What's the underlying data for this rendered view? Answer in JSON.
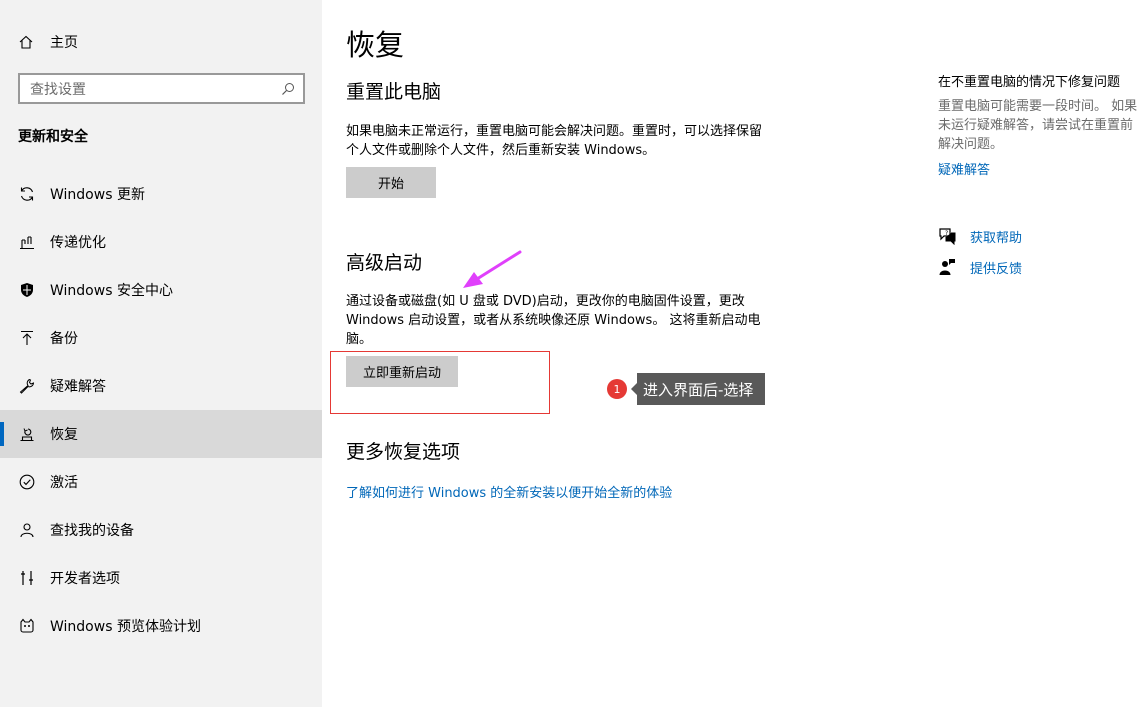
{
  "sidebar": {
    "home_label": "主页",
    "search_placeholder": "查找设置",
    "section_title": "更新和安全",
    "items": [
      {
        "label": "Windows 更新",
        "icon": "refresh-icon"
      },
      {
        "label": "传递优化",
        "icon": "delivery-optimization-icon"
      },
      {
        "label": "Windows 安全中心",
        "icon": "shield-icon"
      },
      {
        "label": "备份",
        "icon": "backup-arrow-icon"
      },
      {
        "label": "疑难解答",
        "icon": "wrench-icon"
      },
      {
        "label": "恢复",
        "icon": "recovery-icon",
        "active": true
      },
      {
        "label": "激活",
        "icon": "check-circle-icon"
      },
      {
        "label": "查找我的设备",
        "icon": "find-device-icon"
      },
      {
        "label": "开发者选项",
        "icon": "developer-icon"
      },
      {
        "label": "Windows 预览体验计划",
        "icon": "insider-icon"
      }
    ]
  },
  "main": {
    "title": "恢复",
    "reset": {
      "heading": "重置此电脑",
      "line1": "如果电脑未正常运行，重置电脑可能会解决问题。重置时，可以选择保留",
      "line2": "个人文件或删除个人文件，然后重新安装 Windows。",
      "button": "开始"
    },
    "advanced": {
      "heading": "高级启动",
      "line1": "通过设备或磁盘(如 U 盘或 DVD)启动，更改你的电脑固件设置，更改",
      "line2": "Windows 启动设置，或者从系统映像还原 Windows。 这将重新启动电",
      "line3": "脑。",
      "button": "立即重新启动"
    },
    "more": {
      "heading": "更多恢复选项",
      "link": "了解如何进行 Windows 的全新安装以便开始全新的体验"
    }
  },
  "right": {
    "title": "在不重置电脑的情况下修复问题",
    "line1": "重置电脑可能需要一段时间。 如果",
    "line2": "未运行疑难解答，请尝试在重置前",
    "line3": "解决问题。",
    "troubleshoot_link": "疑难解答",
    "help_link": "获取帮助",
    "feedback_link": "提供反馈"
  },
  "annotation": {
    "step_number": "1",
    "callout_text": "进入界面后-选择",
    "colors": {
      "box": "#e53935",
      "arrow": "#e040fb",
      "callout_bg": "#595959"
    }
  }
}
